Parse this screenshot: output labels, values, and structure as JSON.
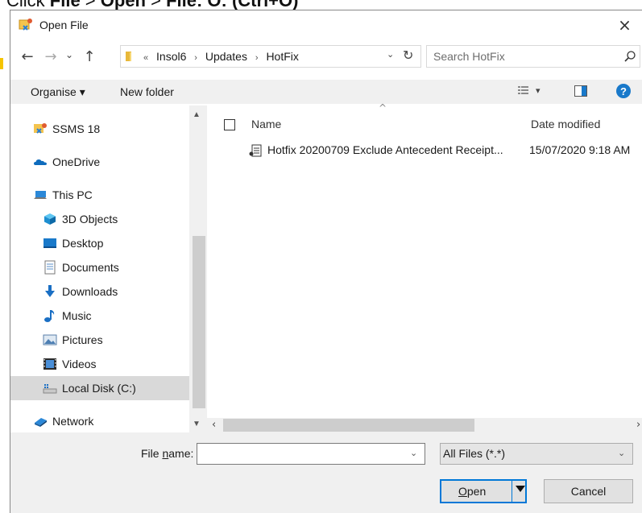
{
  "doc_caption": {
    "prefix": "Click ",
    "file": "File",
    "sep1": " > ",
    "open": "Open",
    "sep2": " > ",
    "shortcut": "File: O: (Ctrl+O)"
  },
  "dialog": {
    "title": "Open File",
    "close": "×"
  },
  "navbar": {
    "back": "←",
    "forward": "→",
    "recent": "⌄",
    "up": "↑",
    "breadcrumb_overflow": "«",
    "crumbs": [
      "Insol6",
      "Updates",
      "HotFix"
    ],
    "crumb_sep": "›",
    "dropdown": "⌄",
    "refresh": "↻",
    "search_placeholder": "Search HotFix"
  },
  "commandbar": {
    "organise": "Organise ▾",
    "new_folder": "New folder",
    "view_dropdown": "▾",
    "help": "?"
  },
  "navpane": {
    "items": [
      {
        "label": "SSMS 18",
        "icon": "ssms-icon"
      },
      {
        "label": "OneDrive",
        "icon": "cloud-icon"
      },
      {
        "label": "This PC",
        "icon": "computer-icon"
      },
      {
        "label": "3D Objects",
        "icon": "cube-icon"
      },
      {
        "label": "Desktop",
        "icon": "desktop-icon"
      },
      {
        "label": "Documents",
        "icon": "documents-icon"
      },
      {
        "label": "Downloads",
        "icon": "download-icon"
      },
      {
        "label": "Music",
        "icon": "music-icon"
      },
      {
        "label": "Pictures",
        "icon": "pictures-icon"
      },
      {
        "label": "Videos",
        "icon": "videos-icon"
      },
      {
        "label": "Local Disk (C:)",
        "icon": "drive-icon"
      },
      {
        "label": "Network",
        "icon": "network-icon"
      }
    ],
    "selected": "Local Disk (C:)"
  },
  "filelist": {
    "columns": {
      "name": "Name",
      "date": "Date modified"
    },
    "files": [
      {
        "name": "Hotfix 20200709 Exclude Antecedent Receipt...",
        "date": "15/07/2020 9:18 AM"
      }
    ]
  },
  "bottom": {
    "filename_label": {
      "pre": "File ",
      "accel": "n",
      "post": "ame:"
    },
    "filename_value": "",
    "filetype": "All Files (*.*)",
    "open": {
      "accel": "O",
      "rest": "pen"
    },
    "cancel": "Cancel"
  },
  "colors": {
    "accent": "#0078d7",
    "selected_bg": "#d9d9d9",
    "panel_bg": "#f0f0f0",
    "help_blue": "#1979ca"
  }
}
